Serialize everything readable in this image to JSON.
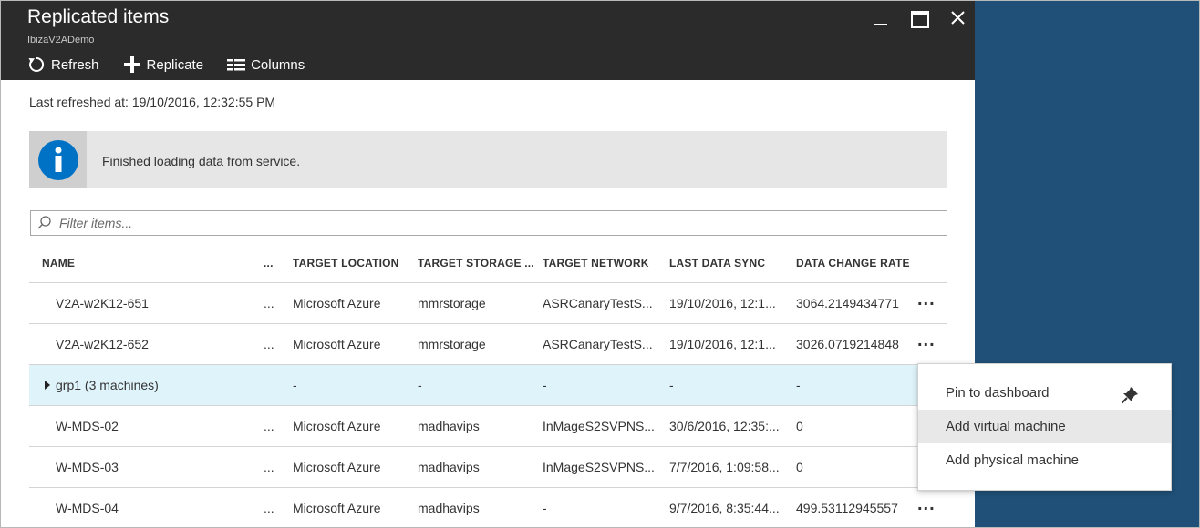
{
  "blade": {
    "title": "Replicated items",
    "subtitle": "IbizaV2ADemo"
  },
  "toolbar": {
    "refresh_label": "Refresh",
    "replicate_label": "Replicate",
    "columns_label": "Columns"
  },
  "status": {
    "last_refreshed": "Last refreshed at: 19/10/2016, 12:32:55 PM"
  },
  "info": {
    "message": "Finished loading data from service.",
    "color": "#0072c6"
  },
  "filter": {
    "placeholder": "Filter items...",
    "value": ""
  },
  "columns": {
    "name": "NAME",
    "hidden": "...",
    "target_location": "TARGET LOCATION",
    "target_storage": "TARGET STORAGE ...",
    "target_network": "TARGET NETWORK",
    "last_data_sync": "LAST DATA SYNC",
    "data_change_rate": "DATA CHANGE RATE"
  },
  "rows": [
    {
      "name": "V2A-w2K12-651",
      "dot": "...",
      "location": "Microsoft Azure",
      "storage": "mmrstorage",
      "network": "ASRCanaryTestS...",
      "sync": "19/10/2016, 12:1...",
      "rate": "3064.2149434771",
      "more": "..."
    },
    {
      "name": "V2A-w2K12-652",
      "dot": "...",
      "location": "Microsoft Azure",
      "storage": "mmrstorage",
      "network": "ASRCanaryTestS...",
      "sync": "19/10/2016, 12:1...",
      "rate": "3026.0719214848",
      "more": "..."
    },
    {
      "name": "grp1 (3 machines)",
      "dot": "",
      "location": "-",
      "storage": "-",
      "network": "-",
      "sync": "-",
      "rate": "-",
      "more": ""
    },
    {
      "name": "W-MDS-02",
      "dot": "...",
      "location": "Microsoft Azure",
      "storage": "madhavips",
      "network": "InMageS2SVPNS...",
      "sync": "30/6/2016, 12:35:...",
      "rate": "0",
      "more": ""
    },
    {
      "name": "W-MDS-03",
      "dot": "...",
      "location": "Microsoft Azure",
      "storage": "madhavips",
      "network": "InMageS2SVPNS...",
      "sync": "7/7/2016, 1:09:58...",
      "rate": "0",
      "more": ""
    },
    {
      "name": "W-MDS-04",
      "dot": "...",
      "location": "Microsoft Azure",
      "storage": "madhavips",
      "network": "-",
      "sync": "9/7/2016, 8:35:44...",
      "rate": "499.53112945557",
      "more": "..."
    }
  ],
  "context_menu": {
    "items": [
      "Pin to dashboard",
      "Add virtual machine",
      "Add physical machine"
    ]
  },
  "colors": {
    "header_bg": "#2b2b2b",
    "selected_row": "#dff3fb",
    "side_panel": "#205078"
  }
}
